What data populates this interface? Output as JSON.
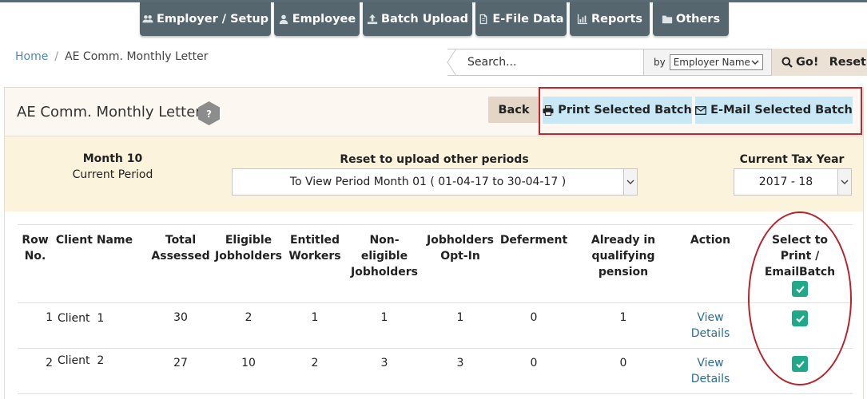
{
  "nav": {
    "tabs": [
      {
        "label": "Employer / Setup",
        "icon": "users-icon"
      },
      {
        "label": "Employee",
        "icon": "user-icon"
      },
      {
        "label": "Batch Upload",
        "icon": "upload-icon"
      },
      {
        "label": "E-File Data",
        "icon": "file-icon"
      },
      {
        "label": "Reports",
        "icon": "bar-chart-icon"
      },
      {
        "label": "Others",
        "icon": "folder-icon"
      }
    ]
  },
  "breadcrumb": {
    "home": "Home",
    "separator": "/",
    "current": "AE Comm. Monthly Letter"
  },
  "search": {
    "placeholder": "Search...",
    "by_label": "by",
    "by_value": "Employer Name",
    "go_label": "Go!",
    "reset_label": "Reset"
  },
  "header": {
    "title": "AE Comm. Monthly Letter",
    "help": "?",
    "back_label": "Back",
    "print_label": "Print Selected Batch",
    "email_label": "E-Mail Selected Batch"
  },
  "period": {
    "month": "Month 10",
    "current": "Current Period",
    "reset_label": "Reset to upload other periods",
    "period_value": "To View Period Month 01 ( 01-04-17 to 30-04-17 )",
    "tax_label": "Current Tax Year",
    "tax_value": "2017 - 18"
  },
  "table": {
    "headers": {
      "row_no": [
        "Row",
        "No."
      ],
      "client": [
        "Client Name"
      ],
      "total": [
        "Total",
        "Assessed"
      ],
      "eligible": [
        "Eligible",
        "Jobholders"
      ],
      "entitled": [
        "Entitled",
        "Workers"
      ],
      "noneligible": [
        "Non-eligible",
        "Jobholders"
      ],
      "optin": [
        "Jobholders",
        "Opt-In"
      ],
      "deferment": [
        "Deferment"
      ],
      "already": [
        "Already in",
        "qualifying",
        "pension"
      ],
      "action": [
        "Action"
      ],
      "select": [
        "Select to",
        "Print /",
        "EmailBatch"
      ]
    },
    "rows": [
      {
        "no": "1",
        "client": "Client  1",
        "total": "30",
        "eligible": "2",
        "entitled": "1",
        "noneligible": "1",
        "optin": "1",
        "deferment": "0",
        "already": "1",
        "action": [
          "View",
          "Details"
        ],
        "selected": true
      },
      {
        "no": "2",
        "client": "Client  2",
        "total": "27",
        "eligible": "10",
        "entitled": "2",
        "noneligible": "3",
        "optin": "3",
        "deferment": "0",
        "already": "0",
        "action": [
          "View",
          "Details"
        ],
        "selected": true
      }
    ]
  },
  "colors": {
    "nav": "#56666f",
    "accent_button": "#c9e8f6",
    "checkbox": "#1fa98a",
    "highlight_red": "#c6252d"
  }
}
